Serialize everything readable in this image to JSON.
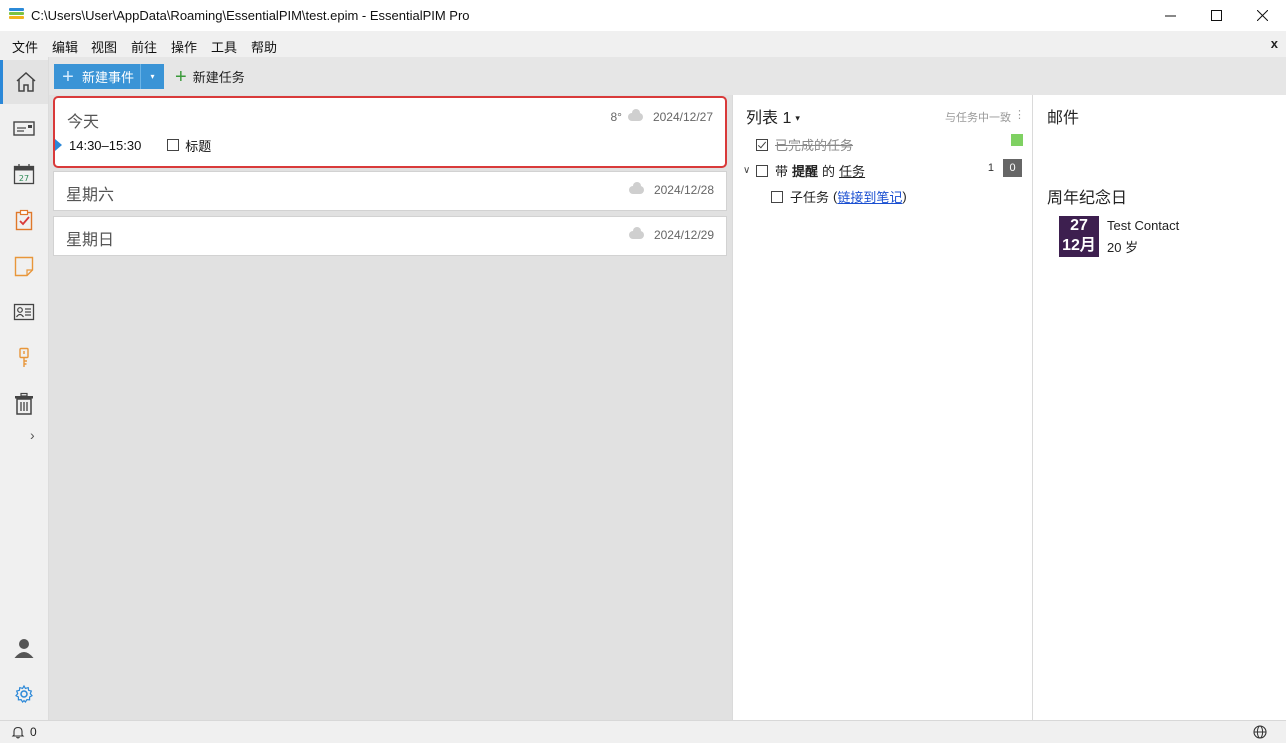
{
  "window": {
    "title": "C:\\Users\\User\\AppData\\Roaming\\EssentialPIM\\test.epim - EssentialPIM Pro",
    "minimize_glyph": "—",
    "maximize_glyph": "☐",
    "close_glyph": "✕"
  },
  "menu": {
    "items": [
      "文件",
      "编辑",
      "视图",
      "前往",
      "操作",
      "工具",
      "帮助"
    ],
    "close_label": "x"
  },
  "toolbar": {
    "new_event_label": "新建事件",
    "new_task_label": "新建任务",
    "dropdown_glyph": "▾"
  },
  "days": [
    {
      "title": "今天",
      "temperature": "8°",
      "date": "2024/12/27",
      "event": {
        "time": "14:30–15:30",
        "title": "标题"
      }
    },
    {
      "title": "星期六",
      "date": "2024/12/28"
    },
    {
      "title": "星期日",
      "date": "2024/12/29"
    }
  ],
  "tasks": {
    "list_title": "列表 1",
    "list_caret": "▾",
    "hint": "与任务中一致",
    "completed_label": "已完成的任务",
    "task_prefix": "带",
    "task_bold": "提醒",
    "task_mid": "的",
    "task_link": "任务",
    "task_count": "1",
    "badge_count": "0",
    "subtask_label": "子任务",
    "subtask_link": "链接到笔记",
    "paren_open": "(",
    "paren_close": ")"
  },
  "right": {
    "mail_title": "邮件",
    "anniv_title": "周年纪念日",
    "anniv_day": "27",
    "anniv_month": "12月",
    "anniv_name": "Test Contact",
    "anniv_age": "20 岁"
  },
  "status": {
    "bell_count": "0"
  },
  "colors": {
    "accent": "#3a94d6",
    "today_border": "#d93a3a",
    "anniv_bg": "#3d1f4f",
    "completed_flag": "#7fd162"
  }
}
